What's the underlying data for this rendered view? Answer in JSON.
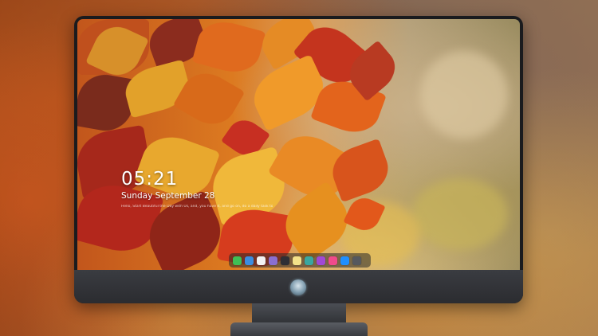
{
  "lockscreen": {
    "time": "05:21",
    "date": "Sunday September 28",
    "note": "Hello, Start Beautiful the Day with Us, and, you have it, and go on, do a daily task to make your day. Ok"
  },
  "dock": {
    "icons": [
      {
        "name": "messages-icon",
        "color": "#3fbf55"
      },
      {
        "name": "finder-icon",
        "color": "#3b8de0"
      },
      {
        "name": "clock-icon",
        "color": "#f2f2f2"
      },
      {
        "name": "photos-icon",
        "color": "#8a6fd0"
      },
      {
        "name": "video-icon",
        "color": "#2f2f35"
      },
      {
        "name": "notes-icon",
        "color": "#f3e28a"
      },
      {
        "name": "image-icon",
        "color": "#3aa7a0"
      },
      {
        "name": "podcasts-icon",
        "color": "#a148d6"
      },
      {
        "name": "music-icon",
        "color": "#f04a8b"
      },
      {
        "name": "appstore-icon",
        "color": "#1f8fff"
      },
      {
        "name": "camera-icon",
        "color": "#55585e"
      }
    ]
  },
  "colors": {
    "monitor_body": "#1a1b1e",
    "chin": "#3a3c41",
    "accent_leaf": "#c72f22"
  }
}
